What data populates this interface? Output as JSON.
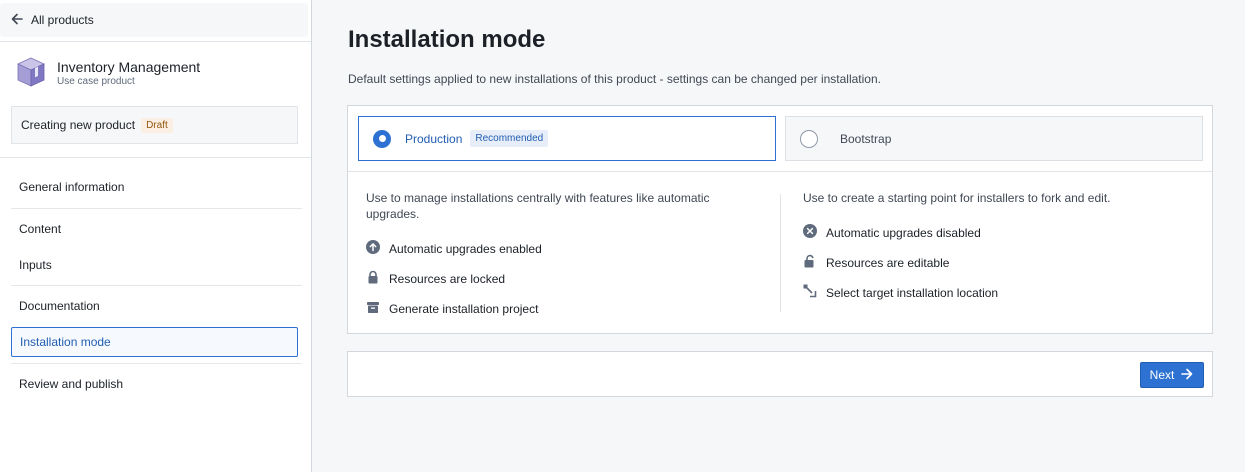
{
  "sidebar": {
    "back_label": "All products",
    "product_name": "Inventory Management",
    "product_sub": "Use case product",
    "creating_label": "Creating new product",
    "draft_tag": "Draft",
    "nav": {
      "general": "General information",
      "content": "Content",
      "inputs": "Inputs",
      "documentation": "Documentation",
      "installation": "Installation mode",
      "review": "Review and publish"
    }
  },
  "main": {
    "title": "Installation mode",
    "subtitle": "Default settings applied to new installations of this product - settings can be changed per installation.",
    "options": {
      "production": {
        "label": "Production",
        "tag": "Recommended",
        "selected": true
      },
      "bootstrap": {
        "label": "Bootstrap",
        "selected": false
      }
    },
    "production": {
      "desc": "Use to manage installations centrally with features like automatic upgrades.",
      "features": [
        "Automatic upgrades enabled",
        "Resources are locked",
        "Generate installation project"
      ]
    },
    "bootstrap": {
      "desc": "Use to create a starting point for installers to fork and edit.",
      "features": [
        "Automatic upgrades disabled",
        "Resources are editable",
        "Select target installation location"
      ]
    },
    "next_label": "Next"
  },
  "colors": {
    "accent": "#2d72d2",
    "draft": "#935610",
    "text": "#1c2127"
  },
  "icons": [
    "arrow-left-icon",
    "product-cube-icon",
    "arrow-up-circle-icon",
    "lock-icon",
    "archive-icon",
    "x-circle-icon",
    "unlock-icon",
    "target-location-icon",
    "arrow-right-icon"
  ]
}
